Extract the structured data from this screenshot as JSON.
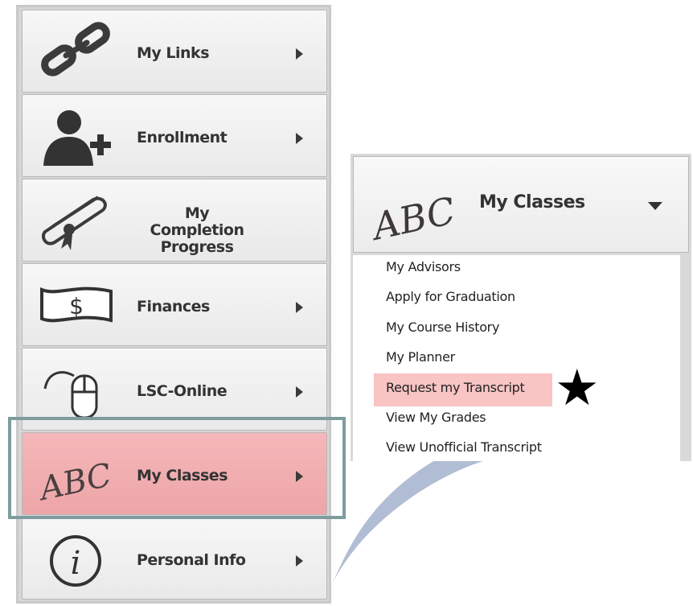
{
  "left_menu": {
    "items": [
      {
        "label": "My Links",
        "icon": "chain-link-icon"
      },
      {
        "label": "Enrollment",
        "icon": "add-user-icon"
      },
      {
        "label_line1": "My Completion",
        "label_line2": "Progress",
        "icon": "diploma-icon"
      },
      {
        "label": "Finances",
        "icon": "dollar-bill-icon"
      },
      {
        "label": "LSC-Online",
        "icon": "mouse-icon"
      },
      {
        "label": "My Classes",
        "icon": "abc-icon",
        "icon_text": "ABC"
      },
      {
        "label": "Personal Info",
        "icon": "info-icon",
        "icon_text": "i"
      }
    ],
    "active_item": "My Classes",
    "active_color": "#f1aeb0"
  },
  "dropdown": {
    "header_label": "My Classes",
    "header_icon_text": "ABC",
    "items": [
      "My Advisors",
      "Apply for Graduation",
      "My Course History",
      "My Planner",
      "Request my Transcript",
      "View My Grades",
      "View Unofficial Transcript"
    ],
    "highlighted_item": "Request my Transcript",
    "highlight_color": "#f8c4c4",
    "marker": "★"
  },
  "colors": {
    "frame": "#7e9c9e",
    "connector": "#a9b6cf"
  }
}
